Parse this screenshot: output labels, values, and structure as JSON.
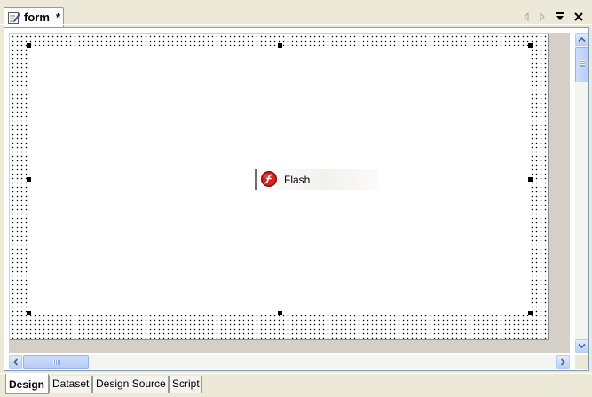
{
  "editor": {
    "tab": {
      "title": "form",
      "dirty_marker": "*",
      "icon": "form-edit-icon"
    },
    "nav_icons": [
      "nav-left-icon",
      "nav-right-icon",
      "tab-list-icon",
      "close-icon"
    ]
  },
  "canvas": {
    "component": {
      "label": "Flash",
      "icon": "flash-player-icon",
      "accent_color": "#d8221c",
      "selected": true
    },
    "grid_visible": true
  },
  "view_tabs": [
    {
      "label": "Design",
      "active": true
    },
    {
      "label": "Dataset",
      "active": false
    },
    {
      "label": "Design Source",
      "active": false
    },
    {
      "label": "Script",
      "active": false
    }
  ]
}
